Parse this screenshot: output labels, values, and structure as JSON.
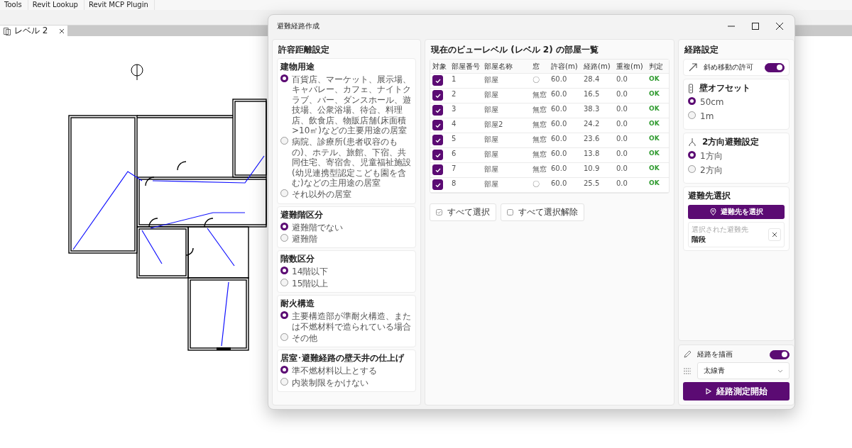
{
  "menu_bar": [
    "Tools",
    "Revit Lookup",
    "Revit MCP Plugin"
  ],
  "view_tab": {
    "label": "レベル 2"
  },
  "dialog": {
    "title": "避難経路作成",
    "left": {
      "title": "許容距離設定",
      "groups": [
        {
          "title": "建物用途",
          "options": [
            {
              "label": "百貨店、マーケット、展示場、キャバレー、カフェ、ナイトクラブ、バー、ダンスホール、遊技場、公衆浴場、待合、料理店、飲食店、物販店舗(床面積>10㎡)などの主要用途の居室",
              "selected": true
            },
            {
              "label": "病院、診療所(患者収容のもの)、ホテル、旅館、下宿、共同住宅、寄宿舎、児童福祉施設(幼児連携型認定こども園を含む)などの主用途の居室",
              "selected": false
            },
            {
              "label": "それ以外の居室",
              "selected": false
            }
          ]
        },
        {
          "title": "避難階区分",
          "options": [
            {
              "label": "避難階でない",
              "selected": true
            },
            {
              "label": "避難階",
              "selected": false
            }
          ]
        },
        {
          "title": "階数区分",
          "options": [
            {
              "label": "14階以下",
              "selected": true
            },
            {
              "label": "15階以上",
              "selected": false
            }
          ]
        },
        {
          "title": "耐火構造",
          "options": [
            {
              "label": "主要構造部が準耐火構造、または不燃材料で造られている場合",
              "selected": true
            },
            {
              "label": "その他",
              "selected": false
            }
          ]
        },
        {
          "title": "居室･避難経路の壁天井の仕上げ",
          "options": [
            {
              "label": "準不燃材料以上とする",
              "selected": true
            },
            {
              "label": "内装制限をかけない",
              "selected": false
            }
          ]
        }
      ]
    },
    "middle": {
      "title": "現在のビューレベル (レベル 2) の部屋一覧",
      "columns": [
        "対象",
        "部屋番号",
        "部屋名称",
        "窓",
        "許容(m)",
        "経路(m)",
        "重複(m)",
        "判定"
      ],
      "rows": [
        {
          "checked": true,
          "number": "1",
          "name": "部屋",
          "window": "〇",
          "allowed": "60.0",
          "route": "28.4",
          "overlap": "0.0",
          "verdict": "OK"
        },
        {
          "checked": true,
          "number": "2",
          "name": "部屋",
          "window": "無窓",
          "allowed": "60.0",
          "route": "16.5",
          "overlap": "0.0",
          "verdict": "OK"
        },
        {
          "checked": true,
          "number": "3",
          "name": "部屋",
          "window": "無窓",
          "allowed": "60.0",
          "route": "38.3",
          "overlap": "0.0",
          "verdict": "OK"
        },
        {
          "checked": true,
          "number": "4",
          "name": "部屋2",
          "window": "無窓",
          "allowed": "60.0",
          "route": "24.2",
          "overlap": "0.0",
          "verdict": "OK"
        },
        {
          "checked": true,
          "number": "5",
          "name": "部屋",
          "window": "無窓",
          "allowed": "60.0",
          "route": "23.6",
          "overlap": "0.0",
          "verdict": "OK"
        },
        {
          "checked": true,
          "number": "6",
          "name": "部屋",
          "window": "無窓",
          "allowed": "60.0",
          "route": "13.8",
          "overlap": "0.0",
          "verdict": "OK"
        },
        {
          "checked": true,
          "number": "7",
          "name": "部屋",
          "window": "無窓",
          "allowed": "60.0",
          "route": "10.9",
          "overlap": "0.0",
          "verdict": "OK"
        },
        {
          "checked": true,
          "number": "8",
          "name": "部屋",
          "window": "〇",
          "allowed": "60.0",
          "route": "25.5",
          "overlap": "0.0",
          "verdict": "OK"
        }
      ],
      "buttons": [
        {
          "kind": "select_all",
          "label": "すべて選択"
        },
        {
          "kind": "deselect_all",
          "label": "すべて選択解除"
        }
      ]
    },
    "right": {
      "title": "経路設定",
      "diagonal": {
        "label": "斜め移動の許可",
        "on": true
      },
      "wall_offset": {
        "title": "壁オフセット",
        "options": [
          {
            "label": "50cm",
            "selected": true
          },
          {
            "label": "1m",
            "selected": false
          }
        ]
      },
      "two_way": {
        "title": "2方向避難設定",
        "options": [
          {
            "label": "1方向",
            "selected": true
          },
          {
            "label": "2方向",
            "selected": false
          }
        ]
      },
      "destination": {
        "title": "避難先選択",
        "button": "避難先を選択",
        "caption": "選択された避難先",
        "value": "階段"
      },
      "draw_route": {
        "label": "経路を描画",
        "on": true
      },
      "line_style": {
        "value": "太線青"
      },
      "start_button": "経路測定開始"
    }
  }
}
